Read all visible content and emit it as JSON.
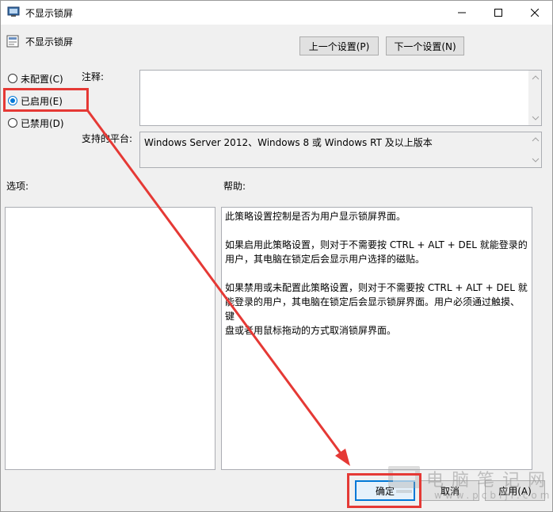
{
  "window": {
    "title": "不显示锁屏",
    "controls": {
      "minimize_icon": "minimize-icon",
      "maximize_icon": "maximize-icon",
      "close_icon": "close-icon"
    }
  },
  "header": {
    "policy_name": "不显示锁屏",
    "prev_button": "上一个设置(P)",
    "next_button": "下一个设置(N)"
  },
  "state_options": [
    {
      "label": "未配置(C)",
      "checked": false
    },
    {
      "label": "已启用(E)",
      "checked": true
    },
    {
      "label": "已禁用(D)",
      "checked": false
    }
  ],
  "comment": {
    "label": "注释:",
    "value": ""
  },
  "platform": {
    "label": "支持的平台:",
    "value": "Windows Server 2012、Windows 8 或 Windows RT 及以上版本"
  },
  "options": {
    "label": "选项:"
  },
  "help": {
    "label": "帮助:",
    "p1": "此策略设置控制是否为用户显示锁屏界面。",
    "p2a": "如果启用此策略设置，则对于不需要按 CTRL + ALT + DEL 就能登录的",
    "p2b": "用户，其电脑在锁定后会显示用户选择的磁贴。",
    "p3a": "如果禁用或未配置此策略设置，则对于不需要按 CTRL + ALT + DEL 就",
    "p3b": "能登录的用户，其电脑在锁定后会显示锁屏界面。用户必须通过触摸、键",
    "p3c": "盘或者用鼠标拖动的方式取消锁屏界面。"
  },
  "buttons": {
    "ok": "确定",
    "cancel": "取消",
    "apply": "应用(A)"
  },
  "watermark": {
    "text": "电脑笔记网",
    "url": "www.pcbiji.com"
  },
  "colors": {
    "accent": "#0078d7",
    "annotation": "#e53935"
  }
}
